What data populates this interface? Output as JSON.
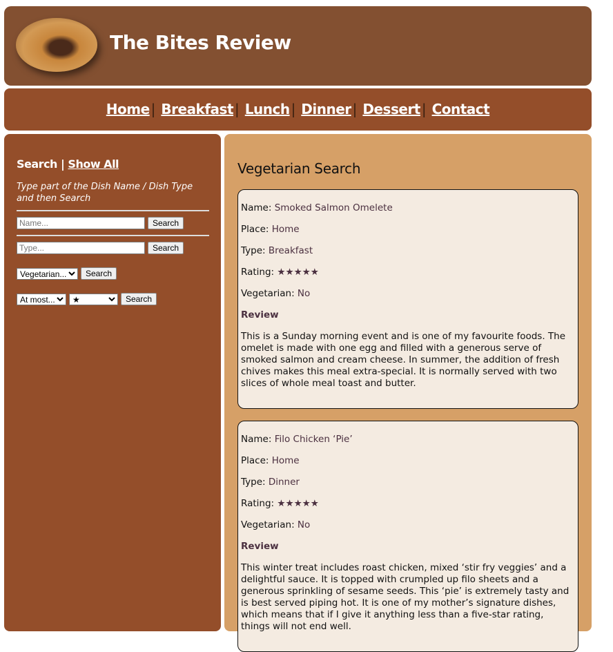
{
  "header": {
    "title": "The Bites Review",
    "logo": "steak-dish-image"
  },
  "nav": [
    "Home",
    "Breakfast",
    "Lunch",
    "Dinner",
    "Dessert",
    "Contact"
  ],
  "sidebar": {
    "search": "Search",
    "show_all": "Show All",
    "hint": "Type part of the Dish Name / Dish Type and then Search",
    "name_placeholder": "Name...",
    "type_placeholder": "Type...",
    "search_btn": "Search",
    "veg_select": "Vegetarian...",
    "rating_mode": "At most...",
    "rating_stars": "★"
  },
  "main": {
    "heading": "Vegetarian Search",
    "labels": {
      "name": "Name:",
      "place": "Place:",
      "type": "Type:",
      "rating": "Rating:",
      "veg": "Vegetarian:",
      "review": "Review"
    },
    "cards": [
      {
        "name": "Smoked Salmon Omelete",
        "place": "Home",
        "type": "Breakfast",
        "rating": "★★★★★",
        "veg": "No",
        "review": "This is a Sunday morning event and is one of my favourite foods. The omelet is made with one egg and filled with a generous serve of smoked salmon and cream cheese. In summer, the addition of fresh chives makes this meal extra-special. It is normally served with two slices of whole meal toast and butter."
      },
      {
        "name": "Filo Chicken ‘Pie’",
        "place": "Home",
        "type": "Dinner",
        "rating": "★★★★★",
        "veg": "No",
        "review": "This winter treat includes roast chicken, mixed ‘stir fry veggies’ and a delightful sauce. It is topped with crumpled up filo sheets and a generous sprinkling of sesame seeds. This ‘pie’ is extremely tasty and is best served piping hot. It is one of my mother’s signature dishes, which means that if I give it anything less than a five-star rating, things will not end well."
      }
    ]
  }
}
